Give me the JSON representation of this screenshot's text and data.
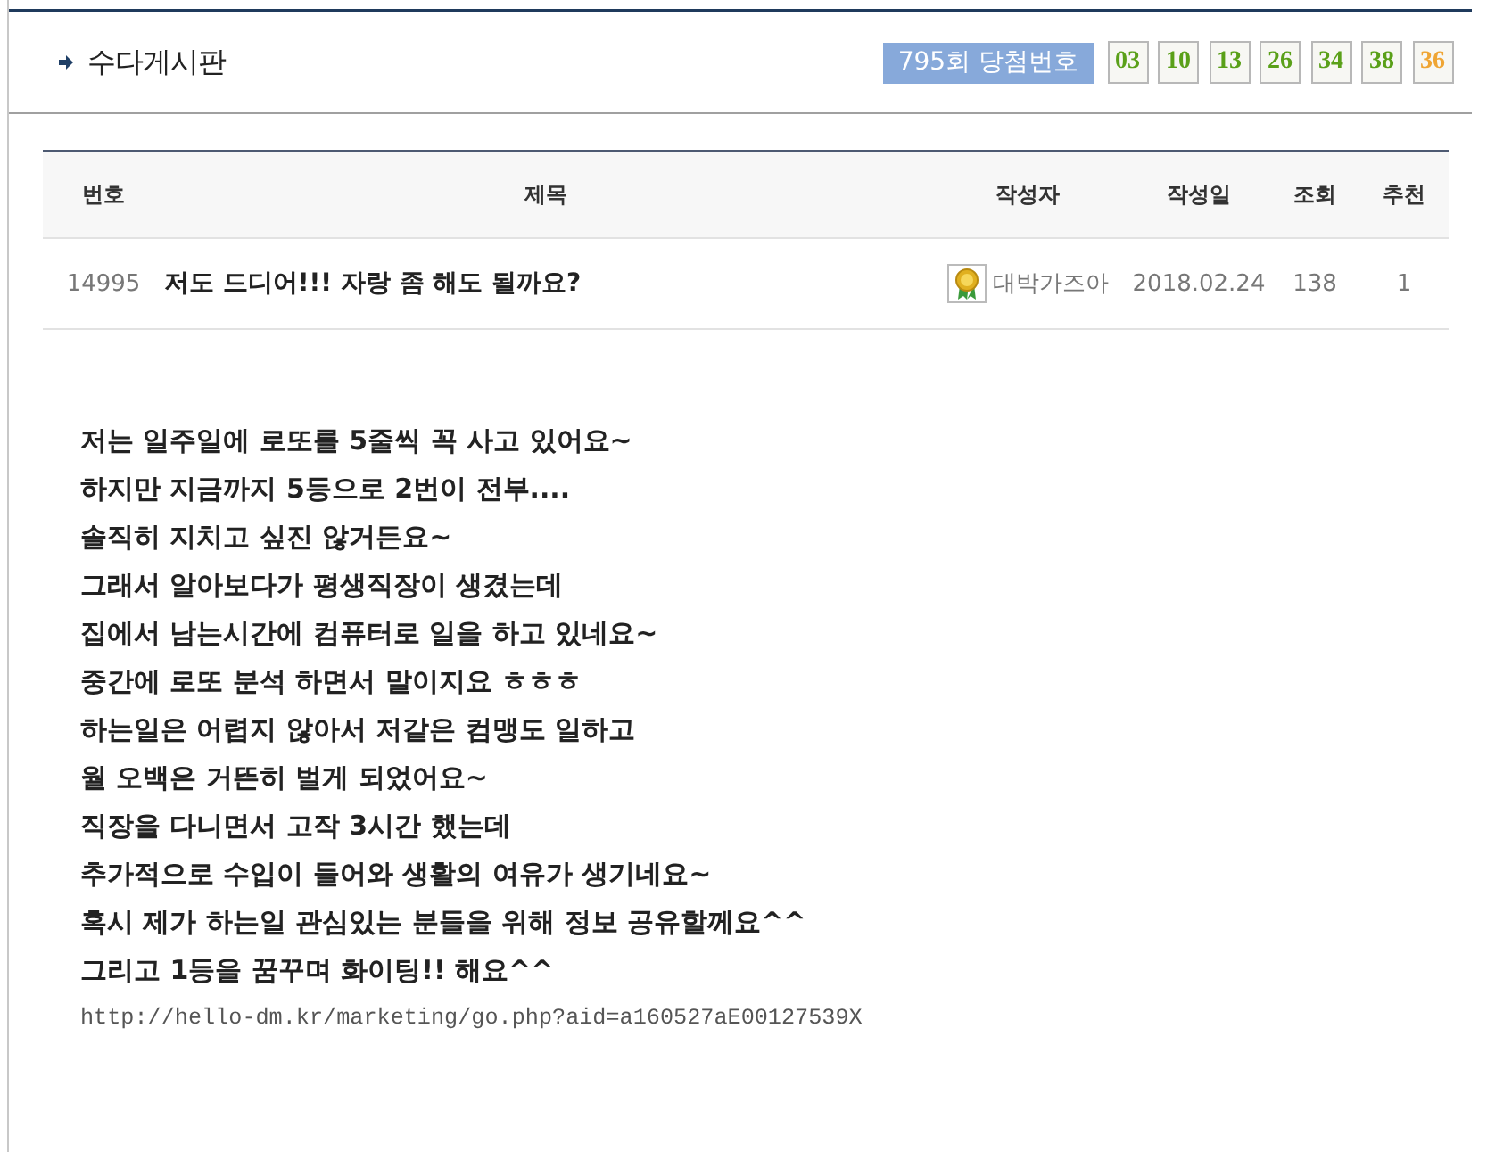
{
  "board": {
    "title": "수다게시판"
  },
  "lotto": {
    "label": "795회 당첨번호",
    "numbers": [
      {
        "value": "03",
        "kind": "main"
      },
      {
        "value": "10",
        "kind": "main"
      },
      {
        "value": "13",
        "kind": "main"
      },
      {
        "value": "26",
        "kind": "main"
      },
      {
        "value": "34",
        "kind": "main"
      },
      {
        "value": "38",
        "kind": "main"
      },
      {
        "value": "36",
        "kind": "bonus"
      }
    ]
  },
  "table": {
    "columns": [
      "번호",
      "제목",
      "작성자",
      "작성일",
      "조회",
      "추천"
    ],
    "rows": [
      {
        "number": "14995",
        "title": "저도 드디어!!! 자랑 좀 해도 될까요?",
        "author": "대박가즈아",
        "date": "2018.02.24",
        "views": "138",
        "recommends": "1"
      }
    ]
  },
  "post": {
    "lines": [
      "저는 일주일에 로또를 5줄씩 꼭 사고 있어요~",
      "하지만 지금까지 5등으로 2번이 전부....",
      "솔직히 지치고 싶진 않거든요~",
      "그래서 알아보다가 평생직장이 생겼는데",
      "집에서 남는시간에 컴퓨터로 일을 하고 있네요~",
      "중간에 로또 분석 하면서 말이지요 ㅎㅎㅎ",
      "하는일은 어렵지 않아서 저같은 컴맹도 일하고",
      "월 오백은 거뜬히 벌게 되었어요~",
      "직장을 다니면서 고작 3시간 했는데",
      "추가적으로 수입이 들어와 생활의 여유가 생기네요~",
      "혹시 제가 하는일 관심있는 분들을 위해 정보 공유할께요^^",
      "그리고 1등을 꿈꾸며 화이팅!! 해요^^"
    ],
    "link": "http://hello-dm.kr/marketing/go.php?aid=a160527aE00127539X"
  }
}
